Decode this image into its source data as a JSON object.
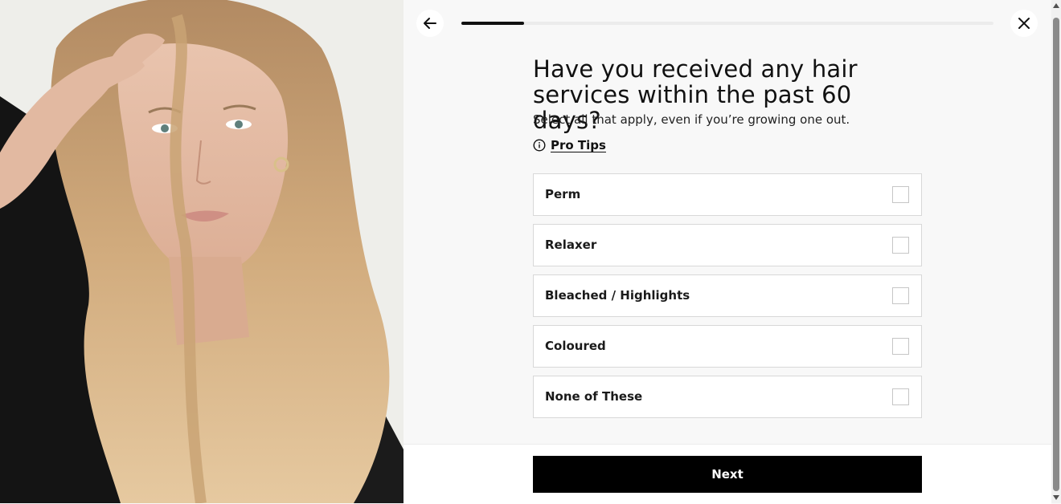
{
  "header": {
    "back_icon": "arrow-left-icon",
    "close_icon": "close-icon",
    "progress_fraction": 0.118
  },
  "question": {
    "title": "Have you received any hair services within the past 60 days?",
    "subtitle": "Select all that apply, even if you’re growing one out."
  },
  "pro_tips": {
    "icon": "info-icon",
    "label": "Pro Tips"
  },
  "options": [
    {
      "label": "Perm",
      "checked": false
    },
    {
      "label": "Relaxer",
      "checked": false
    },
    {
      "label": "Bleached / Highlights",
      "checked": false
    },
    {
      "label": "Coloured",
      "checked": false
    },
    {
      "label": "None of These",
      "checked": false
    }
  ],
  "footer": {
    "next_label": "Next"
  },
  "colors": {
    "accent": "#000000",
    "panel_bg": "#f8f8f8"
  }
}
